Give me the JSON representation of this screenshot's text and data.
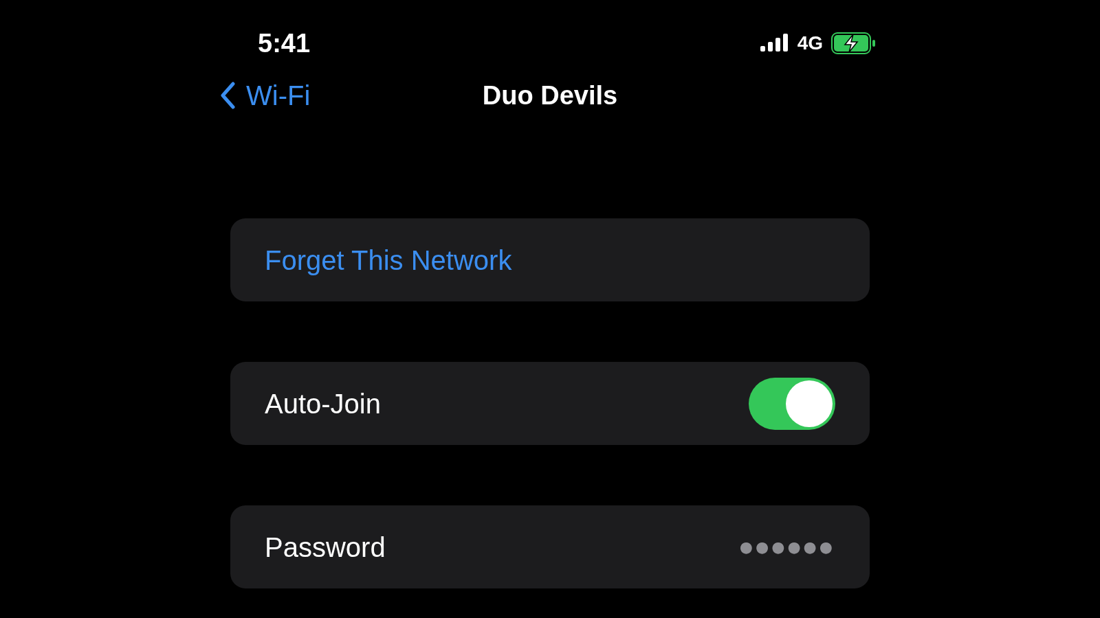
{
  "status_bar": {
    "time": "5:41",
    "network": "4G",
    "charging": true
  },
  "nav": {
    "back": "Wi-Fi",
    "title": "Duo Devils"
  },
  "rows": [
    {
      "kind": "action",
      "label": "Forget This Network"
    },
    {
      "kind": "toggle",
      "label": "Auto-Join",
      "on": true
    },
    {
      "kind": "secret",
      "label": "Password",
      "value": "●●●●●●"
    }
  ]
}
